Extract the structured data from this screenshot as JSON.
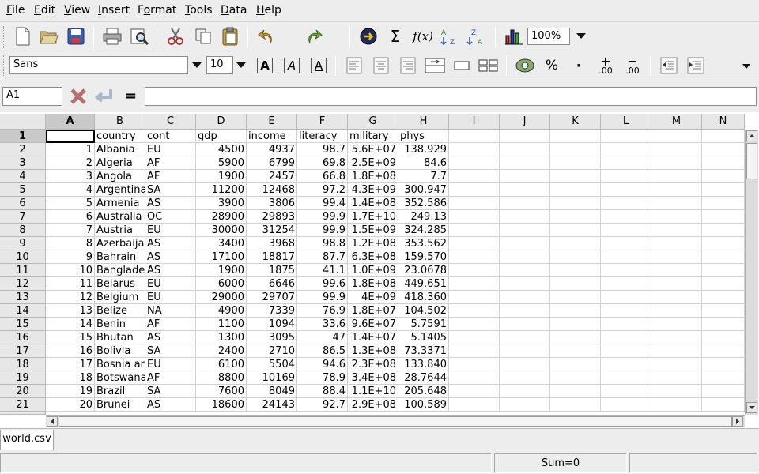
{
  "menu": [
    "File",
    "Edit",
    "View",
    "Insert",
    "Format",
    "Tools",
    "Data",
    "Help"
  ],
  "menu_underline": [
    "F",
    "E",
    "V",
    "I",
    "o",
    "T",
    "D",
    "H"
  ],
  "toolbar": {
    "zoom": "100%",
    "function_label": "f(x)",
    "sum_symbol": "Σ"
  },
  "format_bar": {
    "font_name": "Sans",
    "font_size": "10",
    "bold_label": "A",
    "italic_label": "A",
    "underline_label": "A",
    "percent_label": "%",
    "thousands_label": "·",
    "inc_decimals_label": ".00",
    "dec_decimals_label": ".00"
  },
  "formula_bar": {
    "cell_ref": "A1",
    "equals": "=",
    "content": ""
  },
  "columns": [
    "A",
    "B",
    "C",
    "D",
    "E",
    "F",
    "G",
    "H",
    "I",
    "J",
    "K",
    "L",
    "M",
    "N"
  ],
  "rows": [
    {
      "n": "1",
      "cells": [
        "",
        "country",
        "cont",
        "gdp",
        "income",
        "literacy",
        "military",
        "phys"
      ]
    },
    {
      "n": "2",
      "cells": [
        "1",
        "Albania",
        "EU",
        "4500",
        "4937",
        "98.7",
        "5.6E+07",
        "138.929"
      ]
    },
    {
      "n": "3",
      "cells": [
        "2",
        "Algeria",
        "AF",
        "5900",
        "6799",
        "69.8",
        "2.5E+09",
        "84.6"
      ]
    },
    {
      "n": "4",
      "cells": [
        "3",
        "Angola",
        "AF",
        "1900",
        "2457",
        "66.8",
        "1.8E+08",
        "7.7"
      ]
    },
    {
      "n": "5",
      "cells": [
        "4",
        "Argentina",
        "SA",
        "11200",
        "12468",
        "97.2",
        "4.3E+09",
        "300.947"
      ]
    },
    {
      "n": "6",
      "cells": [
        "5",
        "Armenia",
        "AS",
        "3900",
        "3806",
        "99.4",
        "1.4E+08",
        "352.586"
      ]
    },
    {
      "n": "7",
      "cells": [
        "6",
        "Australia",
        "OC",
        "28900",
        "29893",
        "99.9",
        "1.7E+10",
        "249.13"
      ]
    },
    {
      "n": "8",
      "cells": [
        "7",
        "Austria",
        "EU",
        "30000",
        "31254",
        "99.9",
        "1.5E+09",
        "324.285"
      ]
    },
    {
      "n": "9",
      "cells": [
        "8",
        "Azerbaija",
        "AS",
        "3400",
        "3968",
        "98.8",
        "1.2E+08",
        "353.562"
      ]
    },
    {
      "n": "10",
      "cells": [
        "9",
        "Bahrain",
        "AS",
        "17100",
        "18817",
        "87.7",
        "6.3E+08",
        "159.570"
      ]
    },
    {
      "n": "11",
      "cells": [
        "10",
        "Banglade",
        "AS",
        "1900",
        "1875",
        "41.1",
        "1.0E+09",
        "23.0678"
      ]
    },
    {
      "n": "12",
      "cells": [
        "11",
        "Belarus",
        "EU",
        "6000",
        "6646",
        "99.6",
        "1.8E+08",
        "449.651"
      ]
    },
    {
      "n": "13",
      "cells": [
        "12",
        "Belgium",
        "EU",
        "29000",
        "29707",
        "99.9",
        "4E+09",
        "418.360"
      ]
    },
    {
      "n": "14",
      "cells": [
        "13",
        "Belize",
        "NA",
        "4900",
        "7339",
        "76.9",
        "1.8E+07",
        "104.502"
      ]
    },
    {
      "n": "15",
      "cells": [
        "14",
        "Benin",
        "AF",
        "1100",
        "1094",
        "33.6",
        "9.6E+07",
        "5.7591"
      ]
    },
    {
      "n": "16",
      "cells": [
        "15",
        "Bhutan",
        "AS",
        "1300",
        "3095",
        "47",
        "1.4E+07",
        "5.1405"
      ]
    },
    {
      "n": "17",
      "cells": [
        "16",
        "Bolivia",
        "SA",
        "2400",
        "2710",
        "86.5",
        "1.3E+08",
        "73.3371"
      ]
    },
    {
      "n": "18",
      "cells": [
        "17",
        "Bosnia ar",
        "EU",
        "6100",
        "5504",
        "94.6",
        "2.3E+08",
        "133.840"
      ]
    },
    {
      "n": "19",
      "cells": [
        "18",
        "Botswana",
        "AF",
        "8800",
        "10169",
        "78.9",
        "3.4E+08",
        "28.7644"
      ]
    },
    {
      "n": "20",
      "cells": [
        "19",
        "Brazil",
        "SA",
        "7600",
        "8049",
        "88.4",
        "1.1E+10",
        "205.648"
      ]
    },
    {
      "n": "21",
      "cells": [
        "20",
        "Brunei",
        "AS",
        "18600",
        "24143",
        "92.7",
        "2.9E+08",
        "100.589"
      ]
    }
  ],
  "sheet_tabs": [
    "world.csv"
  ],
  "status": {
    "sum": "Sum=0"
  },
  "colors": {
    "selected_header": "#c9c9c9",
    "grid_line": "#d0d0d0"
  }
}
